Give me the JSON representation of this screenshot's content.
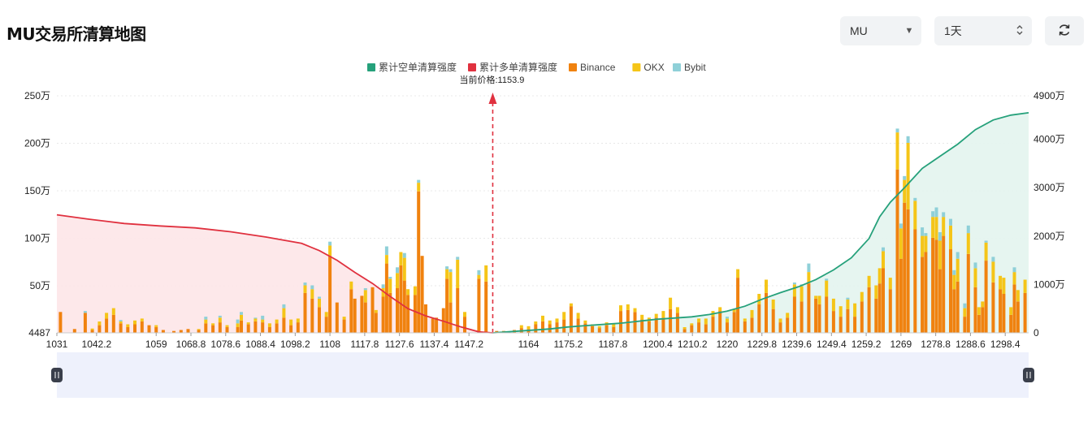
{
  "header": {
    "title": "MU交易所清算地图",
    "symbol_value": "MU",
    "symbol_icon": "caret-down-icon",
    "range_value": "1天",
    "range_icon": "updown-arrows-icon",
    "refresh_icon": "refresh-icon"
  },
  "colors": {
    "short_cum": "#26a17b",
    "long_cum": "#e0313f",
    "binance": "#f0820f",
    "okx": "#f5c518",
    "bybit": "#8fd0d8",
    "short_fill": "#e3f4ee",
    "long_fill": "#fde6e8",
    "price_line": "#e0313f",
    "zoom_fill": "#eef1fc"
  },
  "chart_data": {
    "type": "bar",
    "current_price_label": "当前价格:1153.9",
    "current_price": 1153.9,
    "legend": [
      {
        "name": "累计空单清算强度",
        "color": "#26a17b"
      },
      {
        "name": "累计多单清算强度",
        "color": "#e0313f"
      },
      {
        "name": "Binance",
        "color": "#f0820f"
      },
      {
        "name": "OKX",
        "color": "#f5c518"
      },
      {
        "name": "Bybit",
        "color": "#8fd0d8"
      }
    ],
    "x_ticks": [
      "1031",
      "1042.2",
      "1059",
      "1068.8",
      "1078.6",
      "1088.4",
      "1098.2",
      "1108",
      "1117.8",
      "1127.6",
      "1137.4",
      "1147.2",
      "1164",
      "1175.2",
      "1187.8",
      "1200.4",
      "1210.2",
      "1220",
      "1229.8",
      "1239.6",
      "1249.4",
      "1259.2",
      "1269",
      "1278.8",
      "1288.6",
      "1298.4"
    ],
    "y_left_ticks": [
      "4487",
      "50万",
      "100万",
      "150万",
      "200万",
      "250万"
    ],
    "y_left_values": [
      4487,
      500000,
      1000000,
      1500000,
      2000000,
      2500000
    ],
    "y_left_range": [
      4487,
      2500000
    ],
    "y_right_ticks": [
      "0",
      "1000万",
      "2000万",
      "3000万",
      "4000万",
      "4900万"
    ],
    "y_right_values": [
      0,
      10000000,
      20000000,
      30000000,
      40000000,
      49000000
    ],
    "y_right_range": [
      0,
      49000000
    ],
    "x_range": [
      1031,
      1305
    ],
    "bars": [
      [
        1032,
        220000,
        0,
        0
      ],
      [
        1036,
        40000,
        0,
        0
      ],
      [
        1039,
        210000,
        0,
        20000
      ],
      [
        1041,
        30000,
        15000,
        0
      ],
      [
        1043,
        80000,
        40000,
        0
      ],
      [
        1045,
        150000,
        60000,
        0
      ],
      [
        1047,
        190000,
        70000,
        0
      ],
      [
        1049,
        100000,
        20000,
        15000
      ],
      [
        1051,
        60000,
        30000,
        0
      ],
      [
        1053,
        90000,
        40000,
        0
      ],
      [
        1055,
        120000,
        30000,
        0
      ],
      [
        1057,
        80000,
        0,
        0
      ],
      [
        1059,
        60000,
        20000,
        0
      ],
      [
        1061,
        30000,
        0,
        0
      ],
      [
        1064,
        20000,
        0,
        0
      ],
      [
        1066,
        30000,
        0,
        0
      ],
      [
        1068,
        40000,
        0,
        0
      ],
      [
        1071,
        30000,
        10000,
        0
      ],
      [
        1073,
        100000,
        40000,
        30000
      ],
      [
        1075,
        80000,
        20000,
        0
      ],
      [
        1077,
        110000,
        50000,
        20000
      ],
      [
        1079,
        60000,
        20000,
        0
      ],
      [
        1082,
        60000,
        40000,
        40000
      ],
      [
        1083,
        130000,
        60000,
        30000
      ],
      [
        1085,
        90000,
        20000,
        0
      ],
      [
        1087,
        120000,
        30000,
        10000
      ],
      [
        1089,
        110000,
        30000,
        40000
      ],
      [
        1091,
        60000,
        40000,
        0
      ],
      [
        1093,
        100000,
        40000,
        0
      ],
      [
        1095,
        160000,
        100000,
        40000
      ],
      [
        1097,
        80000,
        60000,
        0
      ],
      [
        1099,
        110000,
        40000,
        0
      ],
      [
        1101,
        420000,
        80000,
        30000
      ],
      [
        1103,
        360000,
        100000,
        40000
      ],
      [
        1105,
        270000,
        90000,
        20000
      ],
      [
        1107,
        170000,
        50000,
        0
      ],
      [
        1108,
        810000,
        110000,
        40000
      ],
      [
        1110,
        320000,
        0,
        0
      ],
      [
        1112,
        140000,
        30000,
        0
      ],
      [
        1114,
        460000,
        80000,
        0
      ],
      [
        1115,
        360000,
        0,
        0
      ],
      [
        1117,
        390000,
        0,
        0
      ],
      [
        1118,
        320000,
        130000,
        20000
      ],
      [
        1120,
        480000,
        0,
        0
      ],
      [
        1121,
        210000,
        30000,
        0
      ],
      [
        1123,
        380000,
        90000,
        40000
      ],
      [
        1124,
        730000,
        90000,
        90000
      ],
      [
        1125,
        420000,
        150000,
        20000
      ],
      [
        1127,
        470000,
        160000,
        60000
      ],
      [
        1128,
        710000,
        140000,
        0
      ],
      [
        1129,
        550000,
        240000,
        50000
      ],
      [
        1130,
        400000,
        60000,
        0
      ],
      [
        1132,
        400000,
        90000,
        0
      ],
      [
        1133,
        1490000,
        90000,
        30000
      ],
      [
        1134,
        810000,
        0,
        0
      ],
      [
        1135,
        300000,
        0,
        0
      ],
      [
        1137,
        150000,
        0,
        0
      ],
      [
        1138,
        160000,
        0,
        0
      ],
      [
        1140,
        260000,
        0,
        0
      ],
      [
        1141,
        570000,
        100000,
        30000
      ],
      [
        1142,
        320000,
        320000,
        30000
      ],
      [
        1144,
        470000,
        300000,
        30000
      ],
      [
        1146,
        170000,
        50000,
        0
      ],
      [
        1150,
        570000,
        40000,
        50000
      ],
      [
        1152,
        540000,
        170000,
        0
      ],
      [
        1155,
        20000,
        0,
        0
      ],
      [
        1157,
        20000,
        0,
        0
      ],
      [
        1160,
        30000,
        0,
        0
      ],
      [
        1162,
        50000,
        30000,
        0
      ],
      [
        1164,
        40000,
        30000,
        0
      ],
      [
        1166,
        90000,
        30000,
        0
      ],
      [
        1168,
        120000,
        60000,
        0
      ],
      [
        1170,
        90000,
        40000,
        0
      ],
      [
        1172,
        110000,
        40000,
        0
      ],
      [
        1174,
        140000,
        80000,
        0
      ],
      [
        1176,
        280000,
        30000,
        0
      ],
      [
        1178,
        150000,
        60000,
        0
      ],
      [
        1180,
        100000,
        30000,
        0
      ],
      [
        1182,
        70000,
        20000,
        0
      ],
      [
        1184,
        50000,
        20000,
        0
      ],
      [
        1186,
        80000,
        30000,
        0
      ],
      [
        1188,
        60000,
        40000,
        0
      ],
      [
        1190,
        230000,
        60000,
        0
      ],
      [
        1192,
        240000,
        60000,
        0
      ],
      [
        1194,
        220000,
        40000,
        0
      ],
      [
        1196,
        140000,
        50000,
        0
      ],
      [
        1198,
        120000,
        40000,
        0
      ],
      [
        1200,
        160000,
        40000,
        0
      ],
      [
        1202,
        160000,
        70000,
        0
      ],
      [
        1204,
        250000,
        120000,
        0
      ],
      [
        1206,
        210000,
        60000,
        0
      ],
      [
        1208,
        40000,
        20000,
        0
      ],
      [
        1210,
        80000,
        20000,
        0
      ],
      [
        1212,
        110000,
        40000,
        0
      ],
      [
        1214,
        90000,
        60000,
        0
      ],
      [
        1216,
        170000,
        60000,
        0
      ],
      [
        1218,
        230000,
        40000,
        0
      ],
      [
        1220,
        110000,
        40000,
        20000
      ],
      [
        1222,
        220000,
        30000,
        0
      ],
      [
        1223,
        580000,
        90000,
        0
      ],
      [
        1225,
        120000,
        30000,
        0
      ],
      [
        1227,
        160000,
        80000,
        0
      ],
      [
        1229,
        300000,
        110000,
        0
      ],
      [
        1231,
        420000,
        140000,
        0
      ],
      [
        1233,
        250000,
        100000,
        0
      ],
      [
        1235,
        110000,
        40000,
        0
      ],
      [
        1237,
        160000,
        50000,
        0
      ],
      [
        1239,
        380000,
        130000,
        20000
      ],
      [
        1241,
        330000,
        160000,
        20000
      ],
      [
        1243,
        520000,
        120000,
        90000
      ],
      [
        1245,
        360000,
        30000,
        0
      ],
      [
        1246,
        300000,
        90000,
        0
      ],
      [
        1248,
        380000,
        170000,
        20000
      ],
      [
        1250,
        230000,
        130000,
        0
      ],
      [
        1252,
        170000,
        110000,
        0
      ],
      [
        1254,
        250000,
        100000,
        20000
      ],
      [
        1256,
        170000,
        140000,
        0
      ],
      [
        1258,
        330000,
        100000,
        0
      ],
      [
        1260,
        480000,
        120000,
        0
      ],
      [
        1262,
        360000,
        140000,
        0
      ],
      [
        1263,
        520000,
        160000,
        0
      ],
      [
        1264,
        680000,
        180000,
        40000
      ],
      [
        1266,
        460000,
        120000,
        0
      ],
      [
        1268,
        1720000,
        390000,
        40000
      ],
      [
        1269,
        780000,
        320000,
        50000
      ],
      [
        1270,
        1370000,
        240000,
        40000
      ],
      [
        1271,
        1300000,
        700000,
        70000
      ],
      [
        1273,
        1090000,
        300000,
        30000
      ],
      [
        1275,
        800000,
        220000,
        90000
      ],
      [
        1276,
        850000,
        170000,
        30000
      ],
      [
        1278,
        1000000,
        220000,
        60000
      ],
      [
        1279,
        980000,
        240000,
        100000
      ],
      [
        1280,
        670000,
        300000,
        90000
      ],
      [
        1281,
        1020000,
        200000,
        50000
      ],
      [
        1283,
        880000,
        250000,
        70000
      ],
      [
        1284,
        460000,
        150000,
        50000
      ],
      [
        1285,
        540000,
        240000,
        70000
      ],
      [
        1287,
        170000,
        90000,
        50000
      ],
      [
        1288,
        830000,
        220000,
        80000
      ],
      [
        1290,
        480000,
        200000,
        60000
      ],
      [
        1291,
        190000,
        80000,
        0
      ],
      [
        1292,
        270000,
        60000,
        0
      ],
      [
        1293,
        760000,
        190000,
        20000
      ],
      [
        1295,
        530000,
        220000,
        50000
      ],
      [
        1297,
        460000,
        140000,
        0
      ],
      [
        1298,
        410000,
        170000,
        0
      ],
      [
        1300,
        190000,
        80000,
        0
      ],
      [
        1301,
        510000,
        130000,
        50000
      ],
      [
        1302,
        330000,
        120000,
        0
      ],
      [
        1304,
        420000,
        140000,
        0
      ]
    ],
    "long_cumulative": [
      [
        1031,
        24400000
      ],
      [
        1040,
        23500000
      ],
      [
        1050,
        22600000
      ],
      [
        1060,
        22100000
      ],
      [
        1070,
        21700000
      ],
      [
        1080,
        20900000
      ],
      [
        1090,
        19800000
      ],
      [
        1100,
        18500000
      ],
      [
        1105,
        17000000
      ],
      [
        1110,
        15000000
      ],
      [
        1115,
        12500000
      ],
      [
        1120,
        10200000
      ],
      [
        1125,
        7500000
      ],
      [
        1130,
        5000000
      ],
      [
        1135,
        3500000
      ],
      [
        1140,
        2400000
      ],
      [
        1145,
        1200000
      ],
      [
        1150,
        200000
      ],
      [
        1153.9,
        0
      ]
    ],
    "short_cumulative": [
      [
        1153.9,
        0
      ],
      [
        1160,
        300000
      ],
      [
        1170,
        800000
      ],
      [
        1175,
        1200000
      ],
      [
        1180,
        1500000
      ],
      [
        1190,
        2000000
      ],
      [
        1200,
        2800000
      ],
      [
        1210,
        3300000
      ],
      [
        1215,
        3800000
      ],
      [
        1220,
        4500000
      ],
      [
        1225,
        5500000
      ],
      [
        1230,
        7000000
      ],
      [
        1235,
        8300000
      ],
      [
        1240,
        9500000
      ],
      [
        1245,
        11000000
      ],
      [
        1250,
        13000000
      ],
      [
        1255,
        15500000
      ],
      [
        1260,
        19500000
      ],
      [
        1263,
        24000000
      ],
      [
        1266,
        27000000
      ],
      [
        1270,
        30000000
      ],
      [
        1275,
        34000000
      ],
      [
        1280,
        36500000
      ],
      [
        1285,
        39000000
      ],
      [
        1290,
        42000000
      ],
      [
        1295,
        44000000
      ],
      [
        1300,
        45000000
      ],
      [
        1305,
        45500000
      ]
    ]
  }
}
